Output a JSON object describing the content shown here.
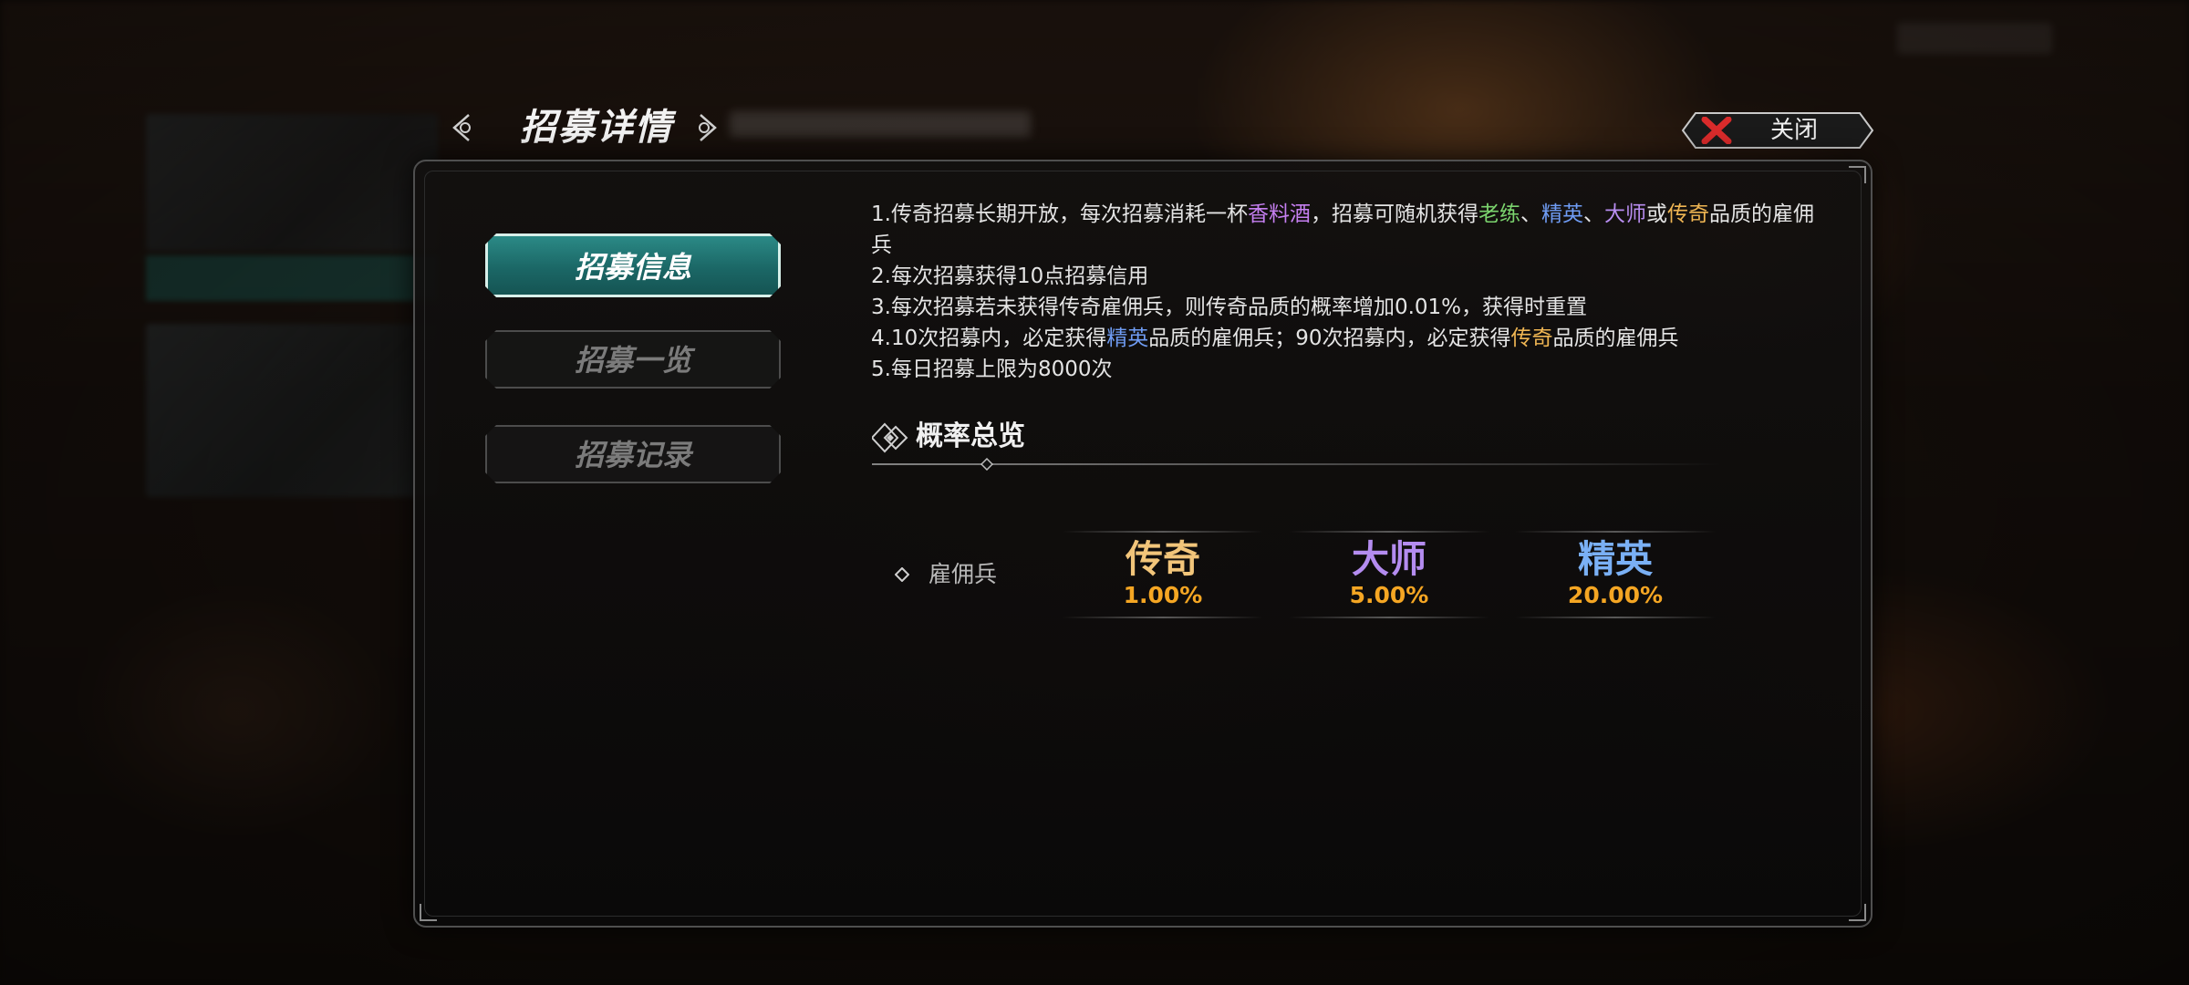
{
  "header": {
    "title": "招募详情",
    "close_label": "关闭"
  },
  "nav": {
    "items": [
      {
        "label": "招募信息",
        "active": true
      },
      {
        "label": "招募一览",
        "active": false
      },
      {
        "label": "招募记录",
        "active": false
      }
    ]
  },
  "rules": {
    "line1": {
      "a": "1.传奇招募长期开放，每次招募消耗一杯",
      "item": "香料酒",
      "b": "，招募可随机获得",
      "q1": "老练",
      "sep1": "、",
      "q2": "精英",
      "sep2": "、",
      "q3": "大师",
      "or": "或",
      "q4": "传奇",
      "c": "品质的雇佣兵"
    },
    "line2": "2.每次招募获得10点招募信用",
    "line3": "3.每次招募若未获得传奇雇佣兵，则传奇品质的概率增加0.01%，获得时重置",
    "line4": {
      "a": "4.10次招募内，必定获得",
      "q1": "精英",
      "b": "品质的雇佣兵；90次招募内，必定获得",
      "q2": "传奇",
      "c": "品质的雇佣兵"
    },
    "line5": "5.每日招募上限为8000次"
  },
  "probability": {
    "section_title": "概率总览",
    "row_label": "雇佣兵",
    "tiers": [
      {
        "name": "传奇",
        "rate": "1.00%"
      },
      {
        "name": "大师",
        "rate": "5.00%"
      },
      {
        "name": "精英",
        "rate": "20.00%"
      }
    ]
  },
  "colors": {
    "accent_teal": "#1b6766",
    "legend_gold": "#f2c57a",
    "master_purple": "#b48cf0",
    "elite_blue": "#7ab0f5",
    "rate_orange": "#f5a623",
    "close_red": "#d92b2b"
  }
}
